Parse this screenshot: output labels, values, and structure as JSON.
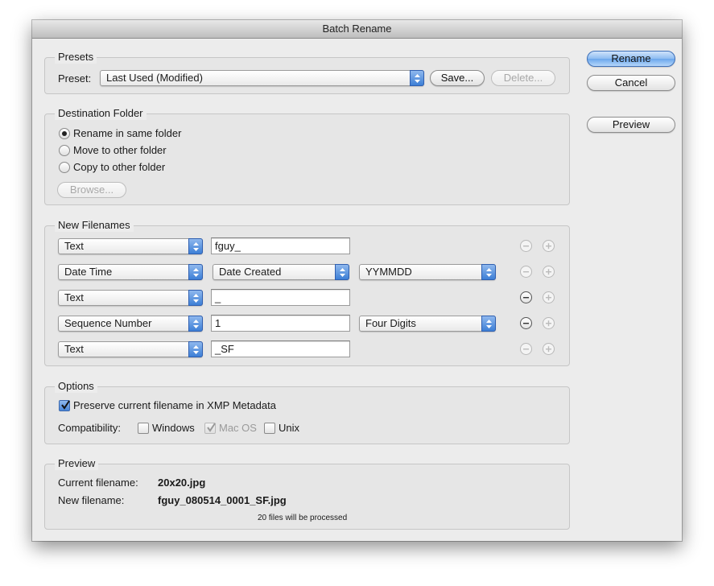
{
  "window": {
    "title": "Batch Rename"
  },
  "buttons": {
    "rename": "Rename",
    "cancel": "Cancel",
    "preview": "Preview"
  },
  "presets": {
    "legend": "Presets",
    "preset_label": "Preset:",
    "preset_value": "Last Used (Modified)",
    "save_label": "Save...",
    "delete_label": "Delete..."
  },
  "destination": {
    "legend": "Destination Folder",
    "options": [
      "Rename in same folder",
      "Move to other folder",
      "Copy to other folder"
    ],
    "selected_index": 0,
    "browse_label": "Browse..."
  },
  "new_filenames": {
    "legend": "New Filenames",
    "rows": [
      {
        "type": "Text",
        "value": "fguy_"
      },
      {
        "type": "Date Time",
        "value": "Date Created",
        "format": "YYMMDD"
      },
      {
        "type": "Text",
        "value": "_"
      },
      {
        "type": "Sequence Number",
        "value": "1",
        "format": "Four Digits"
      },
      {
        "type": "Text",
        "value": "_SF"
      }
    ]
  },
  "options": {
    "legend": "Options",
    "preserve_label": "Preserve current filename in XMP Metadata",
    "preserve_checked": true,
    "compat_label": "Compatibility:",
    "windows_label": "Windows",
    "windows_checked": false,
    "macos_label": "Mac OS",
    "macos_checked": true,
    "unix_label": "Unix",
    "unix_checked": false
  },
  "preview": {
    "legend": "Preview",
    "current_label": "Current filename:",
    "current_value": "20x20.jpg",
    "new_label": "New filename:",
    "new_value": "fguy_080514_0001_SF.jpg",
    "count_text": "20 files will be processed"
  },
  "icons": {
    "popup_arrows": "up-down-arrows-icon",
    "minus": "minus-icon",
    "plus": "plus-icon",
    "check": "checkmark-icon"
  },
  "colors": {
    "accent": "#6aa6ec",
    "window_bg": "#ececec"
  }
}
